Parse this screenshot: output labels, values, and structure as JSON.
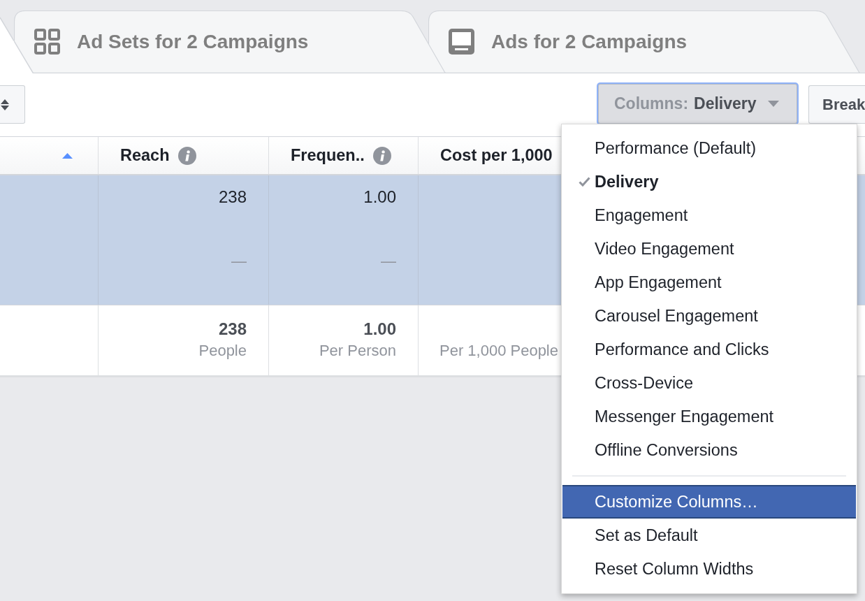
{
  "tabs": [
    {
      "label": "Ad Sets for 2 Campaigns",
      "selected": false
    },
    {
      "label": "Ads for 2 Campaigns",
      "selected": false
    }
  ],
  "toolbar": {
    "columns_button": {
      "label": "Columns:",
      "value": "Delivery",
      "expanded": true
    },
    "breakdown_button": {
      "label": "Break"
    }
  },
  "table": {
    "columns": [
      {
        "sorted": true
      },
      {
        "label": "Reach",
        "info": true
      },
      {
        "label": "Frequen..",
        "info": true
      },
      {
        "label": "Cost per 1,000"
      }
    ],
    "rows": [
      {
        "kind": "data",
        "selected": true,
        "reach": {
          "value": "238",
          "note": "—"
        },
        "frequency": {
          "value": "1.00",
          "note": "—"
        }
      },
      {
        "kind": "summary",
        "selected": false,
        "reach": {
          "value": "238",
          "unit": "People"
        },
        "frequency": {
          "value": "1.00",
          "unit": "Per Person"
        },
        "cost_per_1000": {
          "unit": "Per 1,000 People"
        }
      }
    ]
  },
  "menu": {
    "sections": [
      {
        "items": [
          {
            "label": "Performance (Default)",
            "selected": false,
            "highlighted": false
          },
          {
            "label": "Delivery",
            "selected": true,
            "highlighted": false
          },
          {
            "label": "Engagement",
            "selected": false,
            "highlighted": false
          },
          {
            "label": "Video Engagement",
            "selected": false,
            "highlighted": false
          },
          {
            "label": "App Engagement",
            "selected": false,
            "highlighted": false
          },
          {
            "label": "Carousel Engagement",
            "selected": false,
            "highlighted": false
          },
          {
            "label": "Performance and Clicks",
            "selected": false,
            "highlighted": false
          },
          {
            "label": "Cross-Device",
            "selected": false,
            "highlighted": false
          },
          {
            "label": "Messenger Engagement",
            "selected": false,
            "highlighted": false
          },
          {
            "label": "Offline Conversions",
            "selected": false,
            "highlighted": false
          }
        ]
      },
      {
        "items": [
          {
            "label": "Customize Columns…",
            "highlighted": true
          },
          {
            "label": "Set as Default",
            "highlighted": false
          },
          {
            "label": "Reset Column Widths",
            "highlighted": false
          }
        ]
      }
    ]
  }
}
